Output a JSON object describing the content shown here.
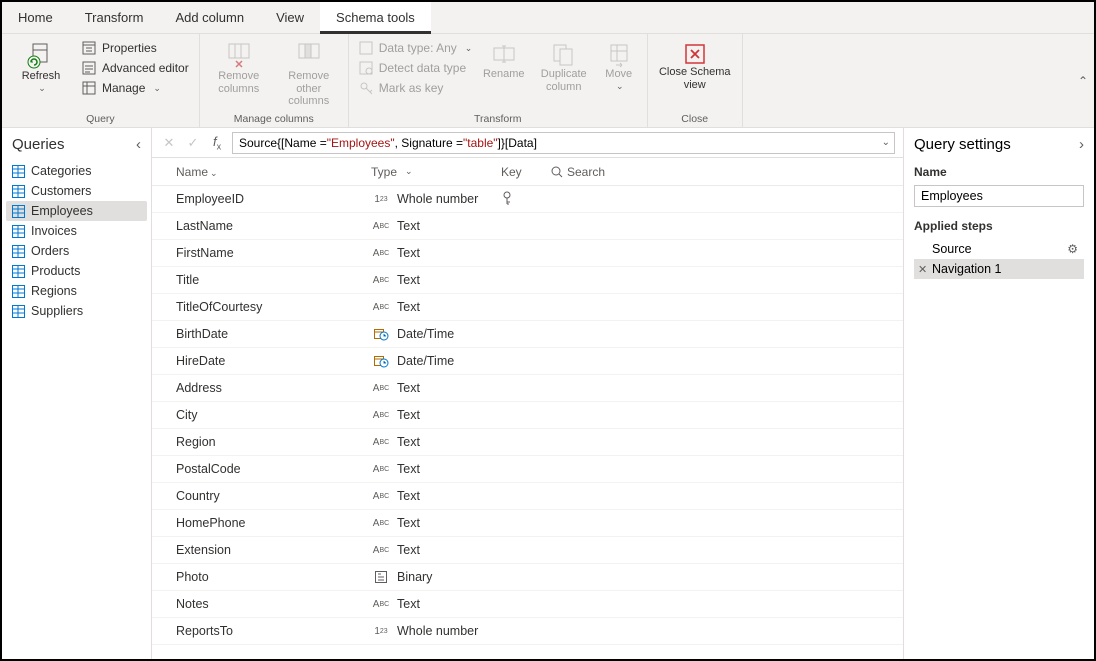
{
  "tabs": [
    "Home",
    "Transform",
    "Add column",
    "View",
    "Schema tools"
  ],
  "active_tab": "Schema tools",
  "ribbon": {
    "groups": {
      "query": {
        "label": "Query",
        "refresh": "Refresh",
        "properties": "Properties",
        "advanced_editor": "Advanced editor",
        "manage": "Manage"
      },
      "manage_columns": {
        "label": "Manage columns",
        "remove_columns": "Remove columns",
        "remove_other": "Remove other columns"
      },
      "transform": {
        "label": "Transform",
        "data_type": "Data type: Any",
        "detect": "Detect data type",
        "mark_key": "Mark as key",
        "rename": "Rename",
        "duplicate": "Duplicate column",
        "move": "Move"
      },
      "close": {
        "label": "Close",
        "close_schema": "Close Schema view"
      }
    }
  },
  "queries_pane": {
    "title": "Queries",
    "items": [
      "Categories",
      "Customers",
      "Employees",
      "Invoices",
      "Orders",
      "Products",
      "Regions",
      "Suppliers"
    ],
    "selected": "Employees"
  },
  "formula": {
    "pre": "Source{[Name = ",
    "s1": "\"Employees\"",
    "mid": ", Signature = ",
    "s2": "\"table\"",
    "post": "]}[Data]"
  },
  "schema": {
    "headers": {
      "name": "Name",
      "type": "Type",
      "key": "Key",
      "search": "Search"
    },
    "rows": [
      {
        "name": "EmployeeID",
        "type": "Whole number",
        "icon": "num",
        "key": true
      },
      {
        "name": "LastName",
        "type": "Text",
        "icon": "abc",
        "key": false
      },
      {
        "name": "FirstName",
        "type": "Text",
        "icon": "abc",
        "key": false
      },
      {
        "name": "Title",
        "type": "Text",
        "icon": "abc",
        "key": false
      },
      {
        "name": "TitleOfCourtesy",
        "type": "Text",
        "icon": "abc",
        "key": false
      },
      {
        "name": "BirthDate",
        "type": "Date/Time",
        "icon": "dt",
        "key": false
      },
      {
        "name": "HireDate",
        "type": "Date/Time",
        "icon": "dt",
        "key": false
      },
      {
        "name": "Address",
        "type": "Text",
        "icon": "abc",
        "key": false
      },
      {
        "name": "City",
        "type": "Text",
        "icon": "abc",
        "key": false
      },
      {
        "name": "Region",
        "type": "Text",
        "icon": "abc",
        "key": false
      },
      {
        "name": "PostalCode",
        "type": "Text",
        "icon": "abc",
        "key": false
      },
      {
        "name": "Country",
        "type": "Text",
        "icon": "abc",
        "key": false
      },
      {
        "name": "HomePhone",
        "type": "Text",
        "icon": "abc",
        "key": false
      },
      {
        "name": "Extension",
        "type": "Text",
        "icon": "abc",
        "key": false
      },
      {
        "name": "Photo",
        "type": "Binary",
        "icon": "bin",
        "key": false
      },
      {
        "name": "Notes",
        "type": "Text",
        "icon": "abc",
        "key": false
      },
      {
        "name": "ReportsTo",
        "type": "Whole number",
        "icon": "num",
        "key": false
      }
    ]
  },
  "settings": {
    "title": "Query settings",
    "name_label": "Name",
    "name_value": "Employees",
    "steps_label": "Applied steps",
    "steps": [
      {
        "label": "Source",
        "gear": true,
        "x": false,
        "sel": false
      },
      {
        "label": "Navigation 1",
        "gear": false,
        "x": true,
        "sel": true
      }
    ]
  }
}
